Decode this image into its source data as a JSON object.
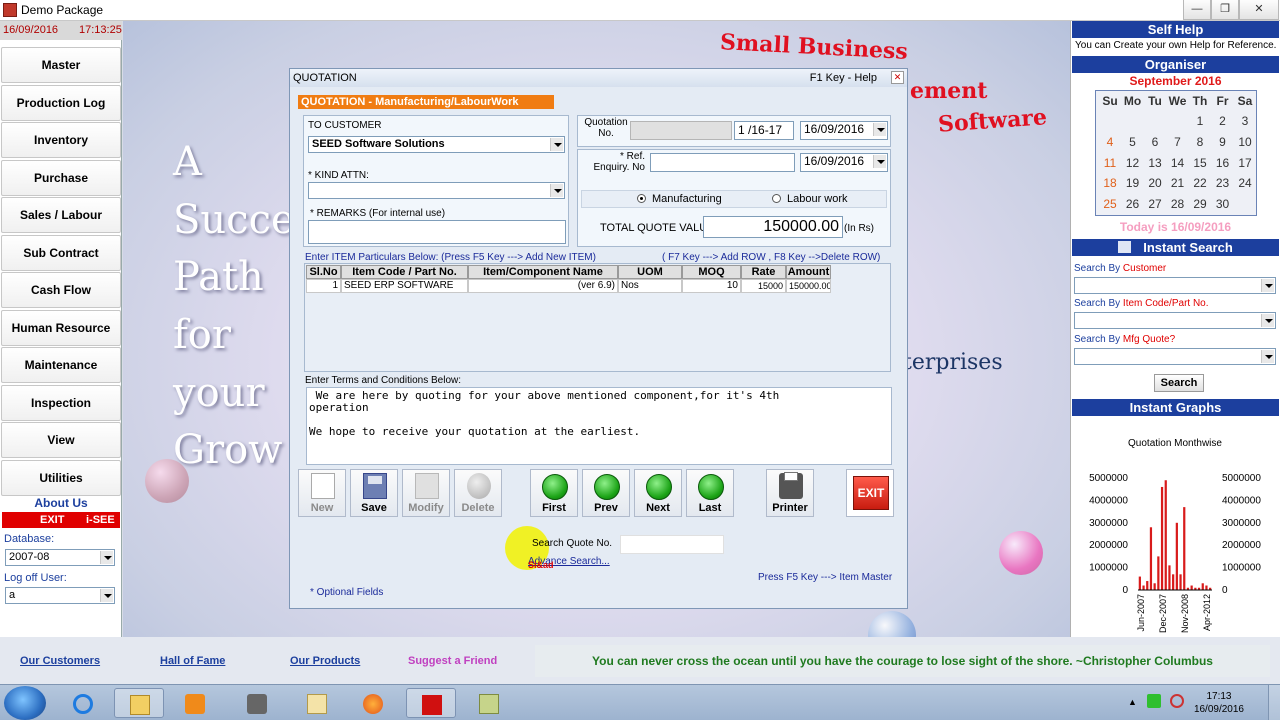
{
  "window": {
    "title": "Demo Package"
  },
  "leftnav": {
    "date": "16/09/2016",
    "time": "17:13:25",
    "items": [
      "Master",
      "Production Log",
      "Inventory",
      "Purchase",
      "Sales / Labour",
      "Sub Contract",
      "Cash Flow",
      "Human Resource",
      "Maintenance",
      "Inspection",
      "View",
      "Utilities"
    ],
    "about": "About  Us",
    "exit": "EXIT",
    "isee": "i-SEE",
    "database_label": "Database:",
    "database_value": "2007-08",
    "logoff_label": "Log off User:",
    "logoff_value": "a"
  },
  "background": {
    "lines": [
      "A",
      "Succe",
      "Path",
      "for",
      "your",
      "Grow"
    ],
    "brand1": "Small Business",
    "brand2": "ement",
    "brand3": "Software",
    "enterprises": "terprises"
  },
  "quotation": {
    "title": "QUOTATION",
    "help": "F1 Key -  Help",
    "subtitle": "QUOTATION - Manufacturing/LabourWork",
    "to_customer_label": "TO  CUSTOMER",
    "customer": "SEED Software Solutions",
    "kind_attn_label": "* KIND ATTN:",
    "remarks_label": "* REMARKS (For internal use)",
    "quotation_no_label1": "Quotation",
    "quotation_no_label2": "No.",
    "quotation_no_prefix": "",
    "quotation_no": "1 /16-17",
    "quotation_date": "16/09/2016",
    "ref_label1": "* Ref.",
    "ref_label2": "Enquiry. No",
    "ref_date": "16/09/2016",
    "manufacturing": "Manufacturing",
    "labour": "Labour work",
    "total_label": "TOTAL QUOTE VALUE",
    "total_value": "150000.00",
    "total_unit": "(In  Rs)",
    "items_hint": "Enter ITEM Particulars Below:  (Press  F5 Key  ---> Add New ITEM)",
    "row_hint": "( F7 Key  ---> Add ROW , F8 Key -->Delete ROW)",
    "columns": [
      "Sl.No",
      "Item Code / Part No.",
      "Item/Component Name",
      "UOM",
      "MOQ",
      "Rate",
      "Amount"
    ],
    "rows": [
      {
        "sl": "1",
        "code": "SEED ERP SOFTWARE",
        "name": "(ver 6.9)",
        "uom": "Nos",
        "moq": "10",
        "rate": "15000",
        "amount": "150000.00"
      }
    ],
    "terms_label": "Enter Terms and Conditions Below:",
    "terms_line1": " We are here by quoting for your above mentioned component,for it's 4th",
    "terms_line2": "operation",
    "terms_line3": "We hope to receive your quotation at the earliest.",
    "buttons": [
      "New",
      "Save",
      "Modify",
      "Delete",
      "First",
      "Prev",
      "Next",
      "Last",
      "Printer"
    ],
    "exit_icon_text": "EXIT",
    "search_quote_label": "Search Quote No.",
    "advance_search": "Advance Search...",
    "cursor_tag": "Si&ad",
    "item_master_hint": "Press  F5 Key  ---> Item Master",
    "optional": "*   Optional Fields"
  },
  "right": {
    "self_help_title": "Self Help",
    "self_help_text": "You can Create your own Help for Reference.",
    "organiser_title": "Organiser",
    "month": "September 2016",
    "weekdays": [
      "Su",
      "Mo",
      "Tu",
      "We",
      "Th",
      "Fr",
      "Sa"
    ],
    "weeks": [
      [
        "",
        "",
        "",
        "",
        "1",
        "2",
        "3"
      ],
      [
        "4",
        "5",
        "6",
        "7",
        "8",
        "9",
        "10"
      ],
      [
        "11",
        "12",
        "13",
        "14",
        "15",
        "16",
        "17"
      ],
      [
        "18",
        "19",
        "20",
        "21",
        "22",
        "23",
        "24"
      ],
      [
        "25",
        "26",
        "27",
        "28",
        "29",
        "30",
        ""
      ]
    ],
    "today": "Today  is 16/09/2016",
    "instant_search_title": "Instant Search",
    "search_by": "Search By",
    "search_customer": "Customer",
    "search_item": "Item Code/Part No.",
    "search_mfg": "Mfg Quote?",
    "search_button": "Search",
    "instant_graphs_title": "Instant Graphs"
  },
  "chart_data": {
    "type": "bar",
    "title": "Quotation Monthwise",
    "y_ticks": [
      "5000000",
      "4000000",
      "3000000",
      "2000000",
      "1000000",
      "0"
    ],
    "x_ticks": [
      "Jun-2007",
      "Dec-2007",
      "Nov-2008",
      "Apr-2012"
    ],
    "ylim": [
      0,
      5000000
    ],
    "values": [
      600000,
      200000,
      400000,
      2800000,
      300000,
      1500000,
      4600000,
      4900000,
      1100000,
      700000,
      3000000,
      700000,
      3700000,
      100000,
      200000,
      100000,
      100000,
      300000,
      200000,
      100000
    ],
    "color": "#d81b1b"
  },
  "bottom": {
    "our_customers": "Our Customers",
    "hall_of_fame": "Hall of Fame",
    "our_products": "Our Products",
    "suggest": "Suggest a Friend",
    "quote": "You can never cross the ocean until you have the courage to lose sight of the shore. ~Christopher Columbus"
  },
  "taskbar": {
    "time": "17:13",
    "date": "16/09/2016"
  },
  "colors": {
    "accent_blue": "#1c3f9e",
    "orange": "#f07c12",
    "exit_red": "#e00000",
    "quote_green": "#1f7a1f"
  }
}
